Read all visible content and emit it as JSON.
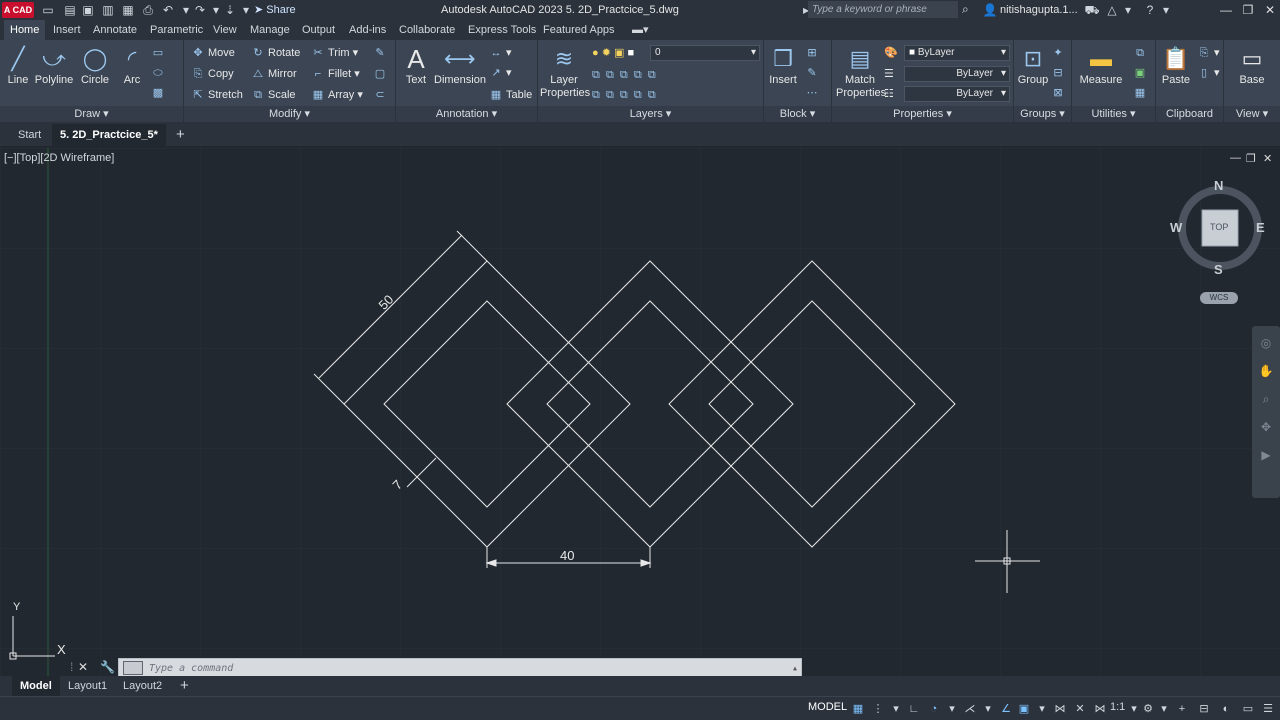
{
  "titlebar": {
    "logo": "A CAD",
    "share": "Share",
    "title": "Autodesk AutoCAD 2023    5. 2D_Practcice_5.dwg",
    "search_placeholder": "Type a keyword or phrase",
    "user": "nitishagupta.1..."
  },
  "ribbon_tabs": [
    "Home",
    "Insert",
    "Annotate",
    "Parametric",
    "View",
    "Manage",
    "Output",
    "Add-ins",
    "Collaborate",
    "Express Tools",
    "Featured Apps"
  ],
  "ribbon": {
    "draw": {
      "label": "Draw",
      "line": "Line",
      "polyline": "Polyline",
      "circle": "Circle",
      "arc": "Arc"
    },
    "modify": {
      "label": "Modify",
      "move": "Move",
      "rotate": "Rotate",
      "trim": "Trim",
      "copy": "Copy",
      "mirror": "Mirror",
      "fillet": "Fillet",
      "stretch": "Stretch",
      "scale": "Scale",
      "array": "Array"
    },
    "annotation": {
      "label": "Annotation",
      "text": "Text",
      "dimension": "Dimension",
      "table": "Table"
    },
    "layers": {
      "label": "Layers",
      "layer_properties": "Layer Properties",
      "current_layer": "0"
    },
    "block": {
      "label": "Block",
      "insert": "Insert"
    },
    "properties": {
      "label": "Properties",
      "match": "Match Properties",
      "color": "ByLayer",
      "linetype": "ByLayer",
      "lineweight": "ByLayer"
    },
    "groups": {
      "label": "Groups",
      "group": "Group"
    },
    "utilities": {
      "label": "Utilities",
      "measure": "Measure"
    },
    "clipboard": {
      "label": "Clipboard",
      "paste": "Paste"
    },
    "view": {
      "label": "View",
      "base": "Base"
    }
  },
  "file_tabs": {
    "start": "Start",
    "current": "5. 2D_Practcice_5*"
  },
  "viewport": {
    "label": "[−][Top][2D Wireframe]",
    "dimensions": {
      "side": "50",
      "thickness": "7",
      "offset": "40"
    },
    "compass": {
      "n": "N",
      "s": "S",
      "e": "E",
      "w": "W",
      "cube": "TOP"
    },
    "wcs": "WCS",
    "ucs_y": "Y",
    "ucs_x": "X"
  },
  "command": {
    "placeholder": "Type  a  command"
  },
  "layout_tabs": [
    "Model",
    "Layout1",
    "Layout2"
  ],
  "status": {
    "model": "MODEL",
    "scale": "1:1"
  }
}
